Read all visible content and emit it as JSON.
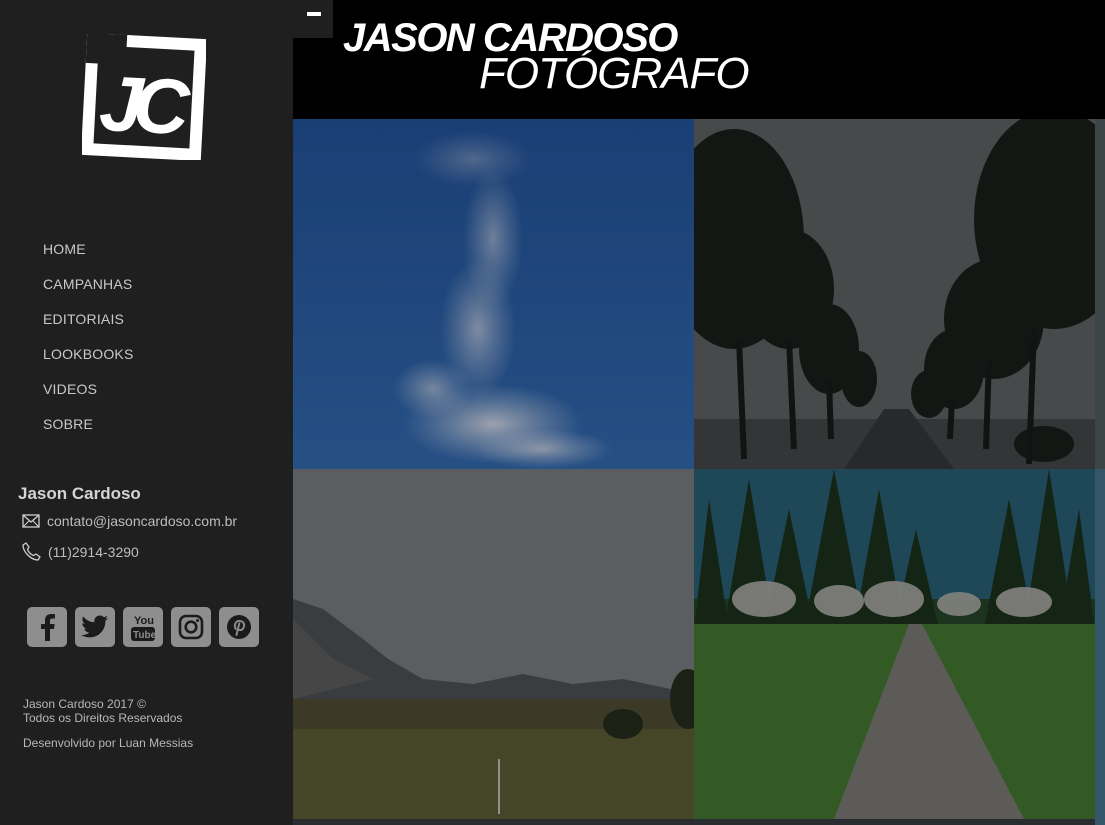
{
  "header": {
    "title": "JASON CARDOSO",
    "subtitle": "FOTÓGRAFO",
    "menu_toggle_icon": "minus-icon"
  },
  "sidebar": {
    "logo_icon": "jc-logo-icon",
    "nav": [
      {
        "label": "HOME"
      },
      {
        "label": "CAMPANHAS"
      },
      {
        "label": "EDITORIAIS"
      },
      {
        "label": "LOOKBOOKS"
      },
      {
        "label": "VIDEOS"
      },
      {
        "label": "SOBRE"
      }
    ],
    "contact": {
      "name": "Jason Cardoso",
      "email": "contato@jasoncardoso.com.br",
      "phone": "(11)2914-3290"
    },
    "social": [
      "facebook-icon",
      "twitter-icon",
      "youtube-icon",
      "instagram-icon",
      "pinterest-icon"
    ],
    "footer": {
      "copyright": "Jason Cardoso 2017 ©",
      "rights": "Todos os Direitos Reservados",
      "developer": "Desenvolvido por Luan Messias"
    }
  },
  "gallery": [
    {
      "subject": "clouds-photo"
    },
    {
      "subject": "tree-lined-road-photo"
    },
    {
      "subject": "mountain-valley-photo"
    },
    {
      "subject": "forest-path-photo"
    }
  ],
  "colors": {
    "sidebar_bg": "#1f1f20",
    "header_bg": "#000000",
    "social_bg": "#8e8e8e"
  }
}
